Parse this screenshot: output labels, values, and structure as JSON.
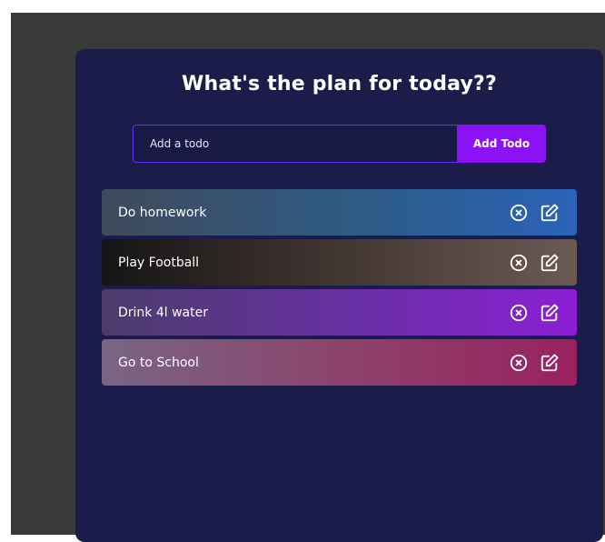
{
  "app": {
    "title": "What's the plan for today??"
  },
  "form": {
    "input_placeholder": "Add a todo",
    "input_value": "",
    "add_label": "Add Todo"
  },
  "todos": [
    {
      "text": "Do homework",
      "delete_icon": "close-circle-icon",
      "edit_icon": "edit-icon"
    },
    {
      "text": "Play Football",
      "delete_icon": "close-circle-icon",
      "edit_icon": "edit-icon"
    },
    {
      "text": "Drink 4l water",
      "delete_icon": "close-circle-icon",
      "edit_icon": "edit-icon"
    },
    {
      "text": "Go to School",
      "delete_icon": "close-circle-icon",
      "edit_icon": "edit-icon"
    }
  ],
  "colors": {
    "page_background": "#3a3a3a",
    "card_background": "#1b1c4a",
    "accent": "#8a12f5",
    "input_border": "#6a2bff"
  }
}
